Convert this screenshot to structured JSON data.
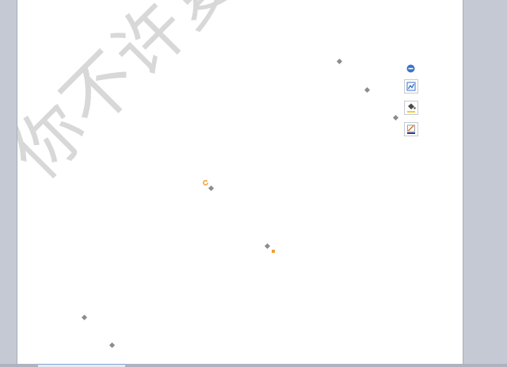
{
  "document": {
    "watermark_text": "你不许复制哦"
  },
  "shape_toolbar": {
    "collapse_icon": "minus-circle-icon",
    "buttons": [
      {
        "name": "shape-layout-button",
        "icon": "wrap-layout-icon"
      },
      {
        "name": "shape-fill-button",
        "icon": "paint-bucket-icon"
      },
      {
        "name": "shape-outline-button",
        "icon": "pen-outline-icon"
      }
    ]
  },
  "colors": {
    "page_background": "#ffffff",
    "workspace_background": "#c5c9d3",
    "watermark": "#d8d8d8",
    "selection_handle": "#8c8c8c",
    "rotate_handle": "#f0a030",
    "accent_blue": "#3b73c9"
  }
}
